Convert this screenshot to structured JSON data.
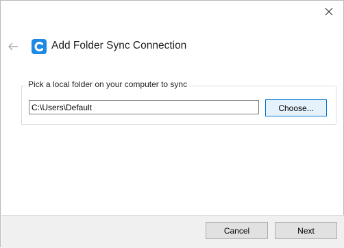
{
  "window": {
    "title": "Add Folder Sync Connection",
    "icons": {
      "close": "close-icon",
      "back": "back-arrow-icon",
      "app": "app-c-icon"
    }
  },
  "group": {
    "label": "Pick a local folder on your computer to sync",
    "path_value": "C:\\Users\\Default",
    "choose_label": "Choose..."
  },
  "footer": {
    "cancel_label": "Cancel",
    "next_label": "Next"
  },
  "colors": {
    "accent": "#0078d7",
    "app_icon": "#1e88e5",
    "footer_bg": "#f0f0f0",
    "button_bg": "#e1e1e1"
  }
}
